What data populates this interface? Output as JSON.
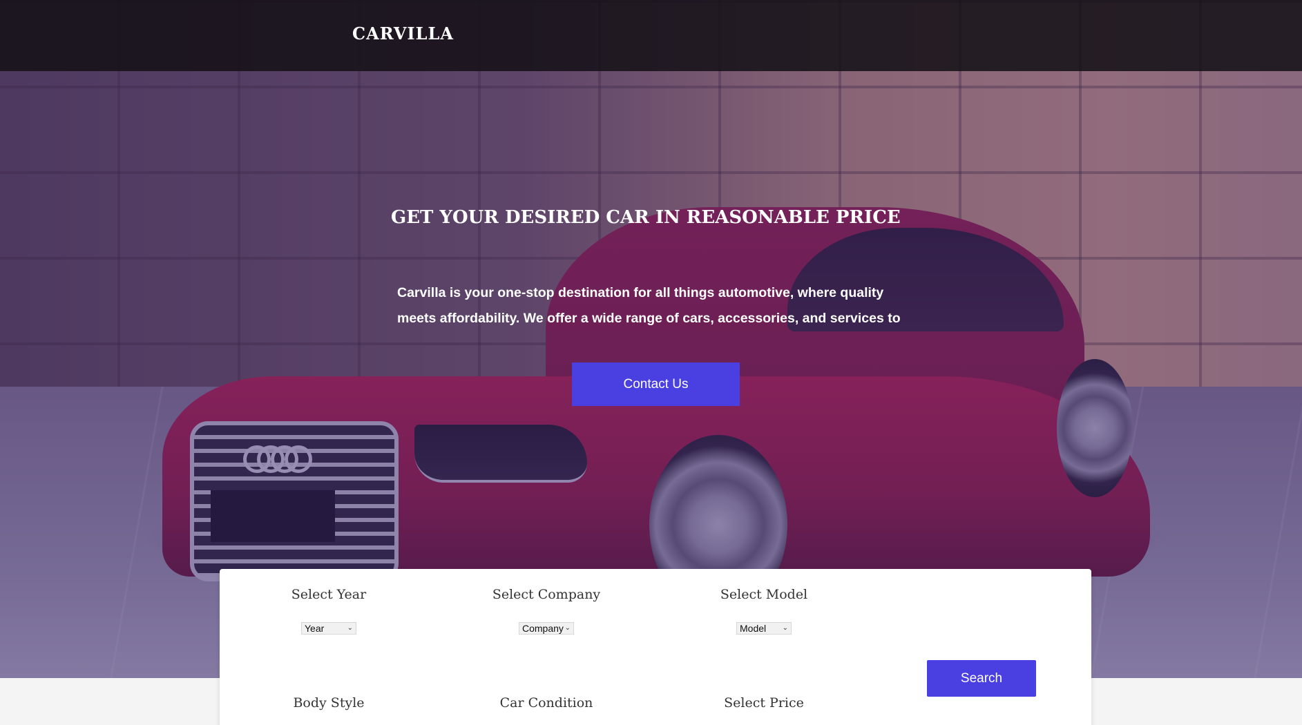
{
  "header": {
    "brand": "CARVILLA"
  },
  "hero": {
    "headline": "GET YOUR DESIRED CAR IN REASONABLE PRICE",
    "intro": "Carvilla is your one-stop destination for all things automotive, where quality meets affordability. We offer a wide range of cars, accessories, and services to",
    "contact_label": "Contact Us"
  },
  "search": {
    "year": {
      "label": "Select Year",
      "value": "Year"
    },
    "company": {
      "label": "Select Company",
      "value": "Company"
    },
    "model": {
      "label": "Select Model",
      "value": "Model"
    },
    "body_style": {
      "label": "Body Style"
    },
    "condition": {
      "label": "Car Condition"
    },
    "price": {
      "label": "Select Price"
    },
    "search_label": "Search"
  },
  "colors": {
    "accent": "#4a3fe0",
    "topbar": "#141016",
    "hero_overlay": "#3c236e"
  }
}
